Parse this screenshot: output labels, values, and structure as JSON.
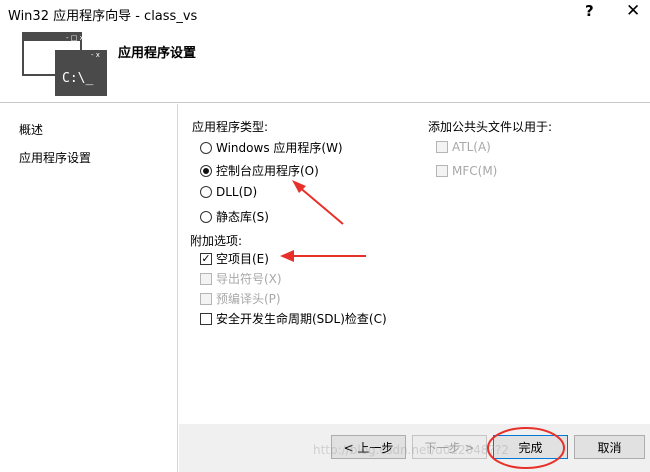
{
  "window": {
    "title": "Win32 应用程序向导 - class_vs",
    "help_label": "?",
    "close_label": "✕"
  },
  "header": {
    "heading": "应用程序设置",
    "logo_text": "C:\\_"
  },
  "sidebar": {
    "items": [
      {
        "label": "概述"
      },
      {
        "label": "应用程序设置"
      }
    ]
  },
  "app_type": {
    "label": "应用程序类型:",
    "options": [
      {
        "label": "Windows 应用程序(W)",
        "selected": false
      },
      {
        "label": "控制台应用程序(O)",
        "selected": true
      },
      {
        "label": "DLL(D)",
        "selected": false
      },
      {
        "label": "静态库(S)",
        "selected": false
      }
    ]
  },
  "common_headers": {
    "label": "添加公共头文件以用于:",
    "options": [
      {
        "label": "ATL(A)",
        "checked": false,
        "enabled": false
      },
      {
        "label": "MFC(M)",
        "checked": false,
        "enabled": false
      }
    ]
  },
  "additional": {
    "label": "附加选项:",
    "options": [
      {
        "label": "空项目(E)",
        "checked": true,
        "enabled": true
      },
      {
        "label": "导出符号(X)",
        "checked": false,
        "enabled": false
      },
      {
        "label": "预编译头(P)",
        "checked": false,
        "enabled": false
      },
      {
        "label": "安全开发生命周期(SDL)检查(C)",
        "checked": false,
        "enabled": true
      }
    ]
  },
  "buttons": {
    "back": "< 上一步",
    "next": "下一步 >",
    "finish": "完成",
    "cancel": "取消"
  },
  "watermark": "http://blog.csdn.net/u012048??2",
  "colors": {
    "annotation_red": "#e8302a",
    "footer_bg": "#f0f0f0",
    "logo_dark": "#4a4a4a"
  }
}
